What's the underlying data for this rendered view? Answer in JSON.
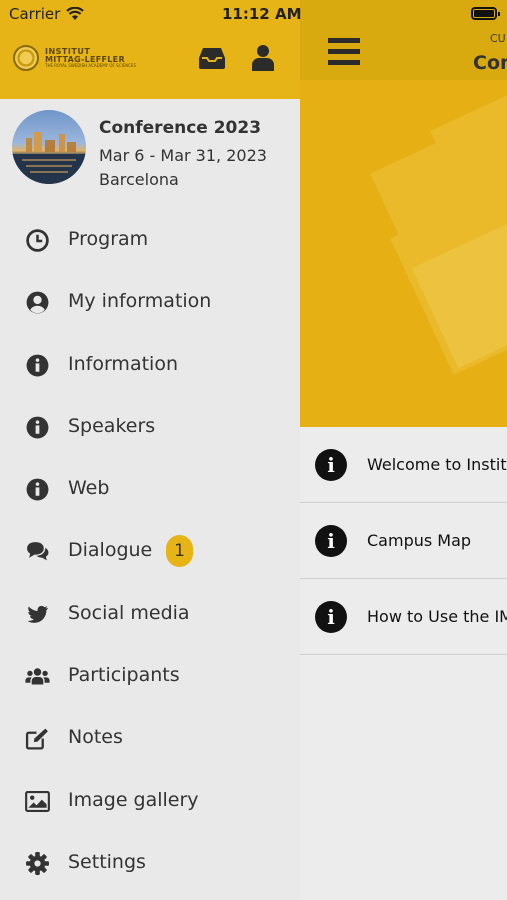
{
  "status_bar": {
    "carrier": "Carrier",
    "time": "11:12 AM"
  },
  "drawer": {
    "logo": {
      "line1": "INSTITUT",
      "line2": "MITTAG-LEFFLER",
      "line3": "THE ROYAL SWEDISH ACADEMY OF SCIENCES"
    },
    "conference": {
      "title": "Conference 2023",
      "dates": "Mar 6 - Mar 31, 2023",
      "city": "Barcelona"
    },
    "menu": [
      {
        "label": "Program",
        "icon": "clock-icon"
      },
      {
        "label": "My information",
        "icon": "user-circle-icon"
      },
      {
        "label": "Information",
        "icon": "info-icon"
      },
      {
        "label": "Speakers",
        "icon": "info-icon"
      },
      {
        "label": "Web",
        "icon": "info-icon"
      },
      {
        "label": "Dialogue",
        "icon": "chat-icon",
        "badge": "1"
      },
      {
        "label": "Social media",
        "icon": "twitter-icon"
      },
      {
        "label": "Participants",
        "icon": "users-icon"
      },
      {
        "label": "Notes",
        "icon": "edit-icon"
      },
      {
        "label": "Image gallery",
        "icon": "image-icon"
      },
      {
        "label": "Settings",
        "icon": "gear-icon"
      }
    ]
  },
  "main": {
    "header_small": "CU",
    "header_title": "Con",
    "list": [
      {
        "label": "Welcome to Instit"
      },
      {
        "label": "Campus Map"
      },
      {
        "label": "How to Use the IM"
      }
    ]
  },
  "colors": {
    "accent": "#e6b416",
    "header_dark": "#d9a910",
    "drawer_bg": "#e9e9e9"
  }
}
